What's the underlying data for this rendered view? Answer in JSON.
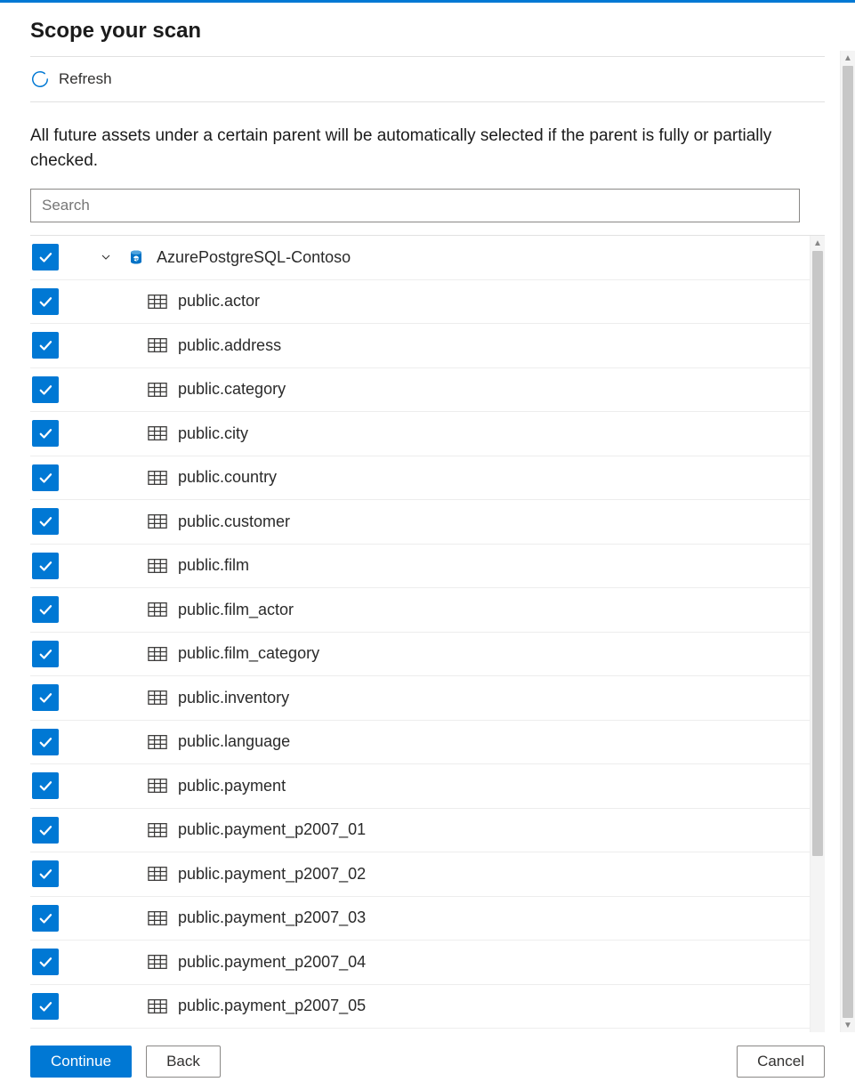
{
  "title": "Scope your scan",
  "refresh_label": "Refresh",
  "description": "All future assets under a certain parent will be automatically selected if the parent is fully or partially checked.",
  "search": {
    "placeholder": "Search"
  },
  "tree": {
    "root": {
      "label": "AzurePostgreSQL-Contoso",
      "checked": true,
      "expanded": true
    },
    "children": [
      {
        "label": "public.actor",
        "checked": true
      },
      {
        "label": "public.address",
        "checked": true
      },
      {
        "label": "public.category",
        "checked": true
      },
      {
        "label": "public.city",
        "checked": true
      },
      {
        "label": "public.country",
        "checked": true
      },
      {
        "label": "public.customer",
        "checked": true
      },
      {
        "label": "public.film",
        "checked": true
      },
      {
        "label": "public.film_actor",
        "checked": true
      },
      {
        "label": "public.film_category",
        "checked": true
      },
      {
        "label": "public.inventory",
        "checked": true
      },
      {
        "label": "public.language",
        "checked": true
      },
      {
        "label": "public.payment",
        "checked": true
      },
      {
        "label": "public.payment_p2007_01",
        "checked": true
      },
      {
        "label": "public.payment_p2007_02",
        "checked": true
      },
      {
        "label": "public.payment_p2007_03",
        "checked": true
      },
      {
        "label": "public.payment_p2007_04",
        "checked": true
      },
      {
        "label": "public.payment_p2007_05",
        "checked": true
      }
    ]
  },
  "footer": {
    "continue": "Continue",
    "back": "Back",
    "cancel": "Cancel"
  }
}
